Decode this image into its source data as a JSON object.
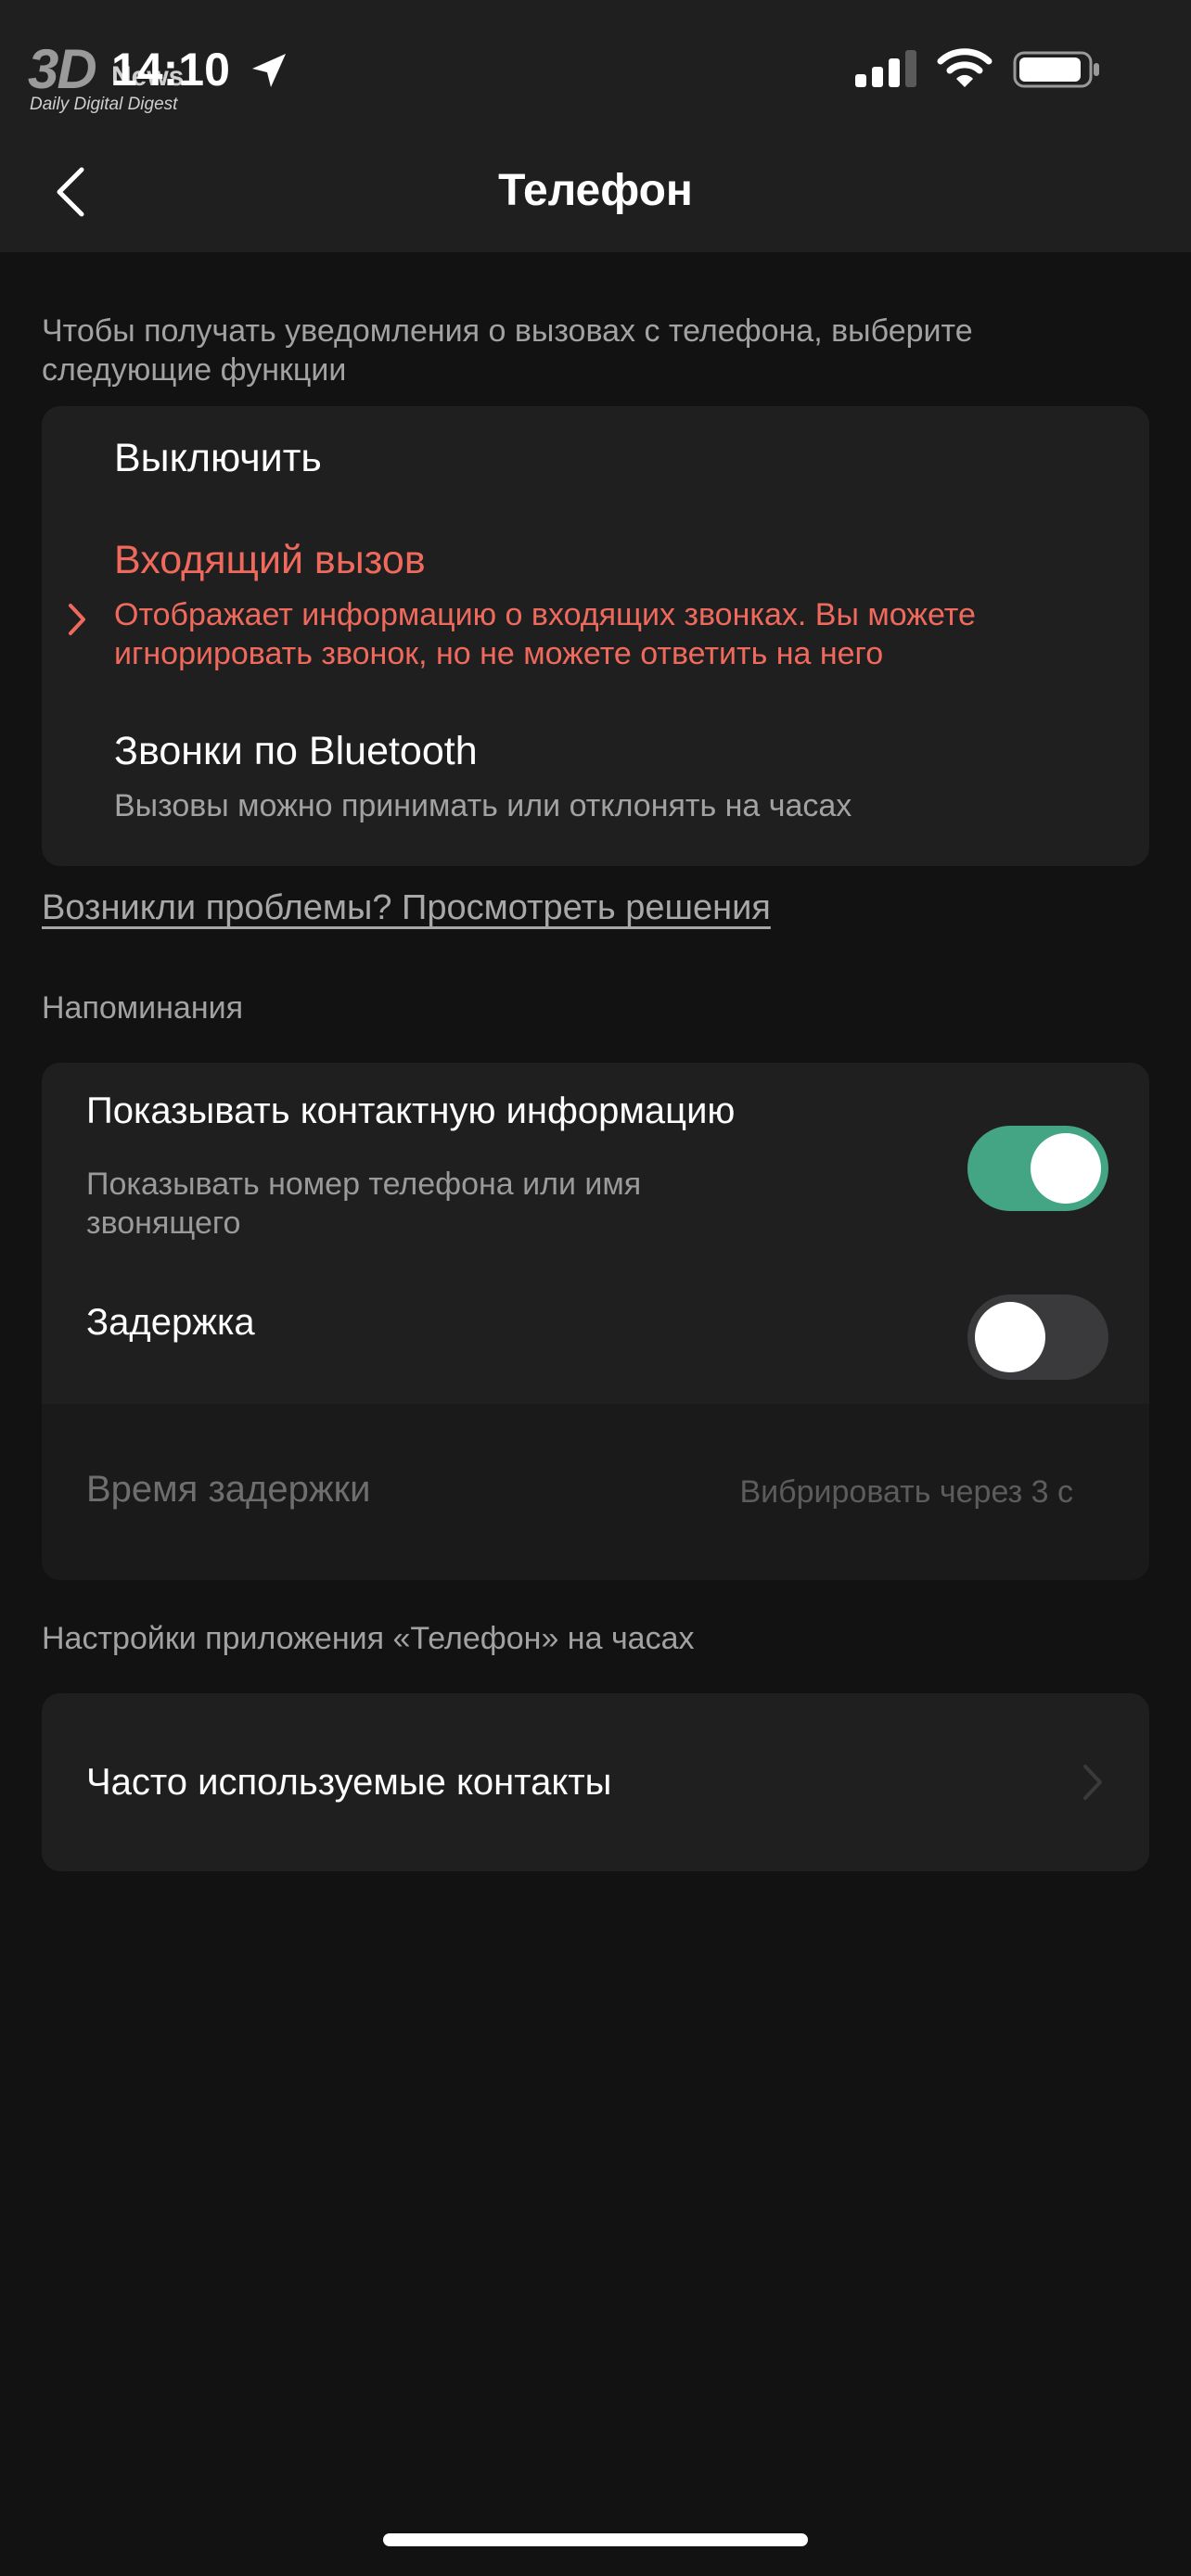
{
  "status_bar": {
    "time": "14:10",
    "watermark_logo": "3DNews",
    "watermark_sub": "Daily Digital Digest",
    "icons": [
      "location-arrow-icon",
      "signal-icon",
      "wifi-icon",
      "battery-icon"
    ]
  },
  "header": {
    "title": "Телефон",
    "back_icon": "chevron-left-icon"
  },
  "call_notifications": {
    "intro": "Чтобы получать уведомления о вызовах с телефона, выберите следующие функции",
    "options": [
      {
        "title": "Выключить",
        "description": ""
      },
      {
        "title": "Входящий вызов",
        "description": "Отображает информацию о входящих звонках. Вы можете игнорировать звонок, но не можете ответить на него",
        "selected": true
      },
      {
        "title": "Звонки по Bluetooth",
        "description": "Вызовы можно принимать или отклонять на часах"
      }
    ],
    "selected_color": "#ef6a5d"
  },
  "help_link": "Возникли проблемы? Просмотреть решения",
  "reminders": {
    "header": "Напоминания",
    "show_contact_info": {
      "title": "Показывать контактную информацию",
      "description": "Показывать номер телефона или имя звонящего",
      "enabled": true
    },
    "delay": {
      "title": "Задержка",
      "enabled": false
    },
    "delay_time": {
      "title": "Время задержки",
      "value": "Вибрировать через 3 с",
      "disabled": true
    },
    "toggle_on_color": "#43a584"
  },
  "watch_app_settings": {
    "header": "Настройки приложения «Телефон» на часах",
    "items": [
      {
        "title": "Часто используемые контакты",
        "icon": "chevron-right-icon"
      }
    ]
  }
}
